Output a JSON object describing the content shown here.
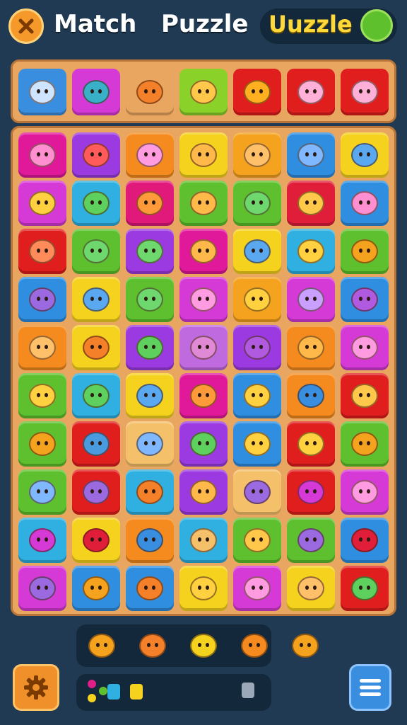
{
  "header": {
    "title_word1": "Match",
    "title_word2": "Puzzle",
    "brand": "Uuzzle"
  },
  "colors": {
    "background": "#1f3a52",
    "board": "#e9a660",
    "accent_yellow": "#ffd83a"
  },
  "icons": {
    "close": "close-x-icon",
    "brand_badge": "green-blob-icon",
    "settings": "gear-icon",
    "menu": "hamburger-menu-icon"
  },
  "tray": [
    {
      "color": "#3a8ee0",
      "icon": "arrow-icon"
    },
    {
      "color": "#d63ad6",
      "icon": "bird-icon"
    },
    {
      "color": "#e9a660",
      "icon": "orange-creature-icon"
    },
    {
      "color": "#8ad12a",
      "icon": "chick-icon"
    },
    {
      "color": "#e01e1e",
      "icon": "egg-icon"
    },
    {
      "color": "#e01e1e",
      "icon": "cat-face-icon"
    },
    {
      "color": "#e01e1e",
      "icon": "cat-face-icon"
    }
  ],
  "board": [
    [
      {
        "tile": "#e0199b",
        "face": "#ff8fd0",
        "icon": "pig-icon"
      },
      {
        "tile": "#9b3ae0",
        "face": "#ff5b5b",
        "icon": "fox-icon"
      },
      {
        "tile": "#f58b1e",
        "face": "#ff9be0",
        "icon": "pig-icon"
      },
      {
        "tile": "#f5d21e",
        "face": "#ffb84a",
        "icon": "lion-icon"
      },
      {
        "tile": "#f5a21e",
        "face": "#ffc06a",
        "icon": "lion-icon"
      },
      {
        "tile": "#2f8ee0",
        "face": "#7fb8ff",
        "icon": "bunny-icon"
      },
      {
        "tile": "#f5d21e",
        "face": "#5aa8f0",
        "icon": "owl-icon"
      }
    ],
    [
      {
        "tile": "#d63ad6",
        "face": "#ffd040",
        "icon": "cat-icon"
      },
      {
        "tile": "#2fb0e0",
        "face": "#5ed05e",
        "icon": "frog-icon"
      },
      {
        "tile": "#e0197a",
        "face": "#ff9a3a",
        "icon": "lion-icon"
      },
      {
        "tile": "#5ec02e",
        "face": "#ffb84a",
        "icon": "hedgehog-icon"
      },
      {
        "tile": "#5ec02e",
        "face": "#6ed86e",
        "icon": "dino-icon"
      },
      {
        "tile": "#e01e3a",
        "face": "#ffc84a",
        "icon": "bee-icon"
      },
      {
        "tile": "#2f8ee0",
        "face": "#ff8fd0",
        "icon": "pig-icon"
      }
    ],
    [
      {
        "tile": "#e01e1e",
        "face": "#ff8a5a",
        "icon": "fox-icon"
      },
      {
        "tile": "#5ec02e",
        "face": "#6ed86e",
        "icon": "frog-icon"
      },
      {
        "tile": "#9b3ae0",
        "face": "#6ed86e",
        "icon": "cat-icon"
      },
      {
        "tile": "#e0199b",
        "face": "#ffb84a",
        "icon": "hedgehog-icon"
      },
      {
        "tile": "#f5d21e",
        "face": "#5aa8f0",
        "icon": "fish-icon"
      },
      {
        "tile": "#2fb0e0",
        "face": "#ffd040",
        "icon": "bee-icon"
      },
      {
        "tile": "#5ec02e",
        "face": "#f5a21e",
        "icon": "carrot-icon"
      }
    ],
    [
      {
        "tile": "#2f8ee0",
        "face": "#9b6ae0",
        "icon": "cat-icon"
      },
      {
        "tile": "#f5d21e",
        "face": "#5aa8f0",
        "icon": "rocket-icon"
      },
      {
        "tile": "#5ec02e",
        "face": "#6ed86e",
        "icon": "frog-icon"
      },
      {
        "tile": "#d63ad6",
        "face": "#ff9be0",
        "icon": "pig-icon"
      },
      {
        "tile": "#f5a21e",
        "face": "#ffd040",
        "icon": "chick-icon"
      },
      {
        "tile": "#d63ad6",
        "face": "#c9a0ff",
        "icon": "cat-icon"
      },
      {
        "tile": "#2f8ee0",
        "face": "#b05ae0",
        "icon": "gift-icon"
      }
    ],
    [
      {
        "tile": "#f58b1e",
        "face": "#ffc06a",
        "icon": "bear-icon"
      },
      {
        "tile": "#f5d21e",
        "face": "#f5802a",
        "icon": "lion-icon"
      },
      {
        "tile": "#9b3ae0",
        "face": "#5ed05e",
        "icon": "carrot-icon"
      },
      {
        "tile": "#c06ae0",
        "face": "#e08ad6",
        "icon": "snail-icon"
      },
      {
        "tile": "#9b3ae0",
        "face": "#b05ae0",
        "icon": "cat-icon"
      },
      {
        "tile": "#f58b1e",
        "face": "#ffb84a",
        "icon": "cat-icon"
      },
      {
        "tile": "#d63ad6",
        "face": "#ff9be0",
        "icon": "pig-icon"
      }
    ],
    [
      {
        "tile": "#5ec02e",
        "face": "#ffd040",
        "icon": "cat-icon"
      },
      {
        "tile": "#2fb0e0",
        "face": "#5ed05e",
        "icon": "frog-icon"
      },
      {
        "tile": "#f5d21e",
        "face": "#5aa8f0",
        "icon": "rocket-icon"
      },
      {
        "tile": "#e0199b",
        "face": "#ff9a3a",
        "icon": "lion-icon"
      },
      {
        "tile": "#2f8ee0",
        "face": "#ffd040",
        "icon": "cat-icon"
      },
      {
        "tile": "#f58b1e",
        "face": "#3a8ee0",
        "icon": "bird-icon"
      },
      {
        "tile": "#e01e1e",
        "face": "#ffc84a",
        "icon": "cat-icon"
      }
    ],
    [
      {
        "tile": "#5ec02e",
        "face": "#f5a21e",
        "icon": "carrot-icon"
      },
      {
        "tile": "#e01e1e",
        "face": "#4a9ae0",
        "icon": "gift-icon"
      },
      {
        "tile": "#f5c06a",
        "face": "#7fb8ff",
        "icon": "fish-icon"
      },
      {
        "tile": "#9b3ae0",
        "face": "#5ed05e",
        "icon": "pepper-icon"
      },
      {
        "tile": "#2f8ee0",
        "face": "#ffd040",
        "icon": "orange-icon"
      },
      {
        "tile": "#e01e1e",
        "face": "#ffd040",
        "icon": "apple-icon"
      },
      {
        "tile": "#5ec02e",
        "face": "#f5a21e",
        "icon": "carrot-icon"
      }
    ],
    [
      {
        "tile": "#5ec02e",
        "face": "#7fb8ff",
        "icon": "cat-icon"
      },
      {
        "tile": "#e01e1e",
        "face": "#9b6ae0",
        "icon": "shell-icon"
      },
      {
        "tile": "#2fb0e0",
        "face": "#f5802a",
        "icon": "bear-icon"
      },
      {
        "tile": "#9b3ae0",
        "face": "#ffb84a",
        "icon": "lion-icon"
      },
      {
        "tile": "#f5c06a",
        "face": "#9b6ae0",
        "icon": "dice-icon"
      },
      {
        "tile": "#e01e1e",
        "face": "#d63ad6",
        "icon": "rocket-icon"
      },
      {
        "tile": "#d63ad6",
        "face": "#ff9be0",
        "icon": "pig-icon"
      }
    ],
    [
      {
        "tile": "#2fb0e0",
        "face": "#d63ad6",
        "icon": "snail-icon"
      },
      {
        "tile": "#f5d21e",
        "face": "#e01e3a",
        "icon": "crayon-icon"
      },
      {
        "tile": "#f58b1e",
        "face": "#3a8ee0",
        "icon": "crayon-icon"
      },
      {
        "tile": "#2fb0e0",
        "face": "#f5c06a",
        "icon": "bone-icon"
      },
      {
        "tile": "#5ec02e",
        "face": "#ffc84a",
        "icon": "bee-icon"
      },
      {
        "tile": "#5ec02e",
        "face": "#9b6ae0",
        "icon": "blob-icon"
      },
      {
        "tile": "#2f8ee0",
        "face": "#e01e3a",
        "icon": "apple-icon"
      }
    ],
    [
      {
        "tile": "#d63ad6",
        "face": "#9b6ae0",
        "icon": "sticks-icon"
      },
      {
        "tile": "#2f8ee0",
        "face": "#f5a21e",
        "icon": "carrot-icon"
      },
      {
        "tile": "#2f8ee0",
        "face": "#f5802a",
        "icon": "bear-icon"
      },
      {
        "tile": "#f5d21e",
        "face": "#ffd040",
        "icon": "cat-icon"
      },
      {
        "tile": "#d63ad6",
        "face": "#ff9be0",
        "icon": "pig-icon"
      },
      {
        "tile": "#f5d21e",
        "face": "#ffc06a",
        "icon": "cat-icon"
      },
      {
        "tile": "#e01e1e",
        "face": "#5ed05e",
        "icon": "leaf-icon"
      }
    ]
  ],
  "collected": [
    {
      "color": "#f5a21e",
      "icon": "shell-icon"
    },
    {
      "color": "#f5802a",
      "icon": "bear-icon"
    },
    {
      "color": "#f5d21e",
      "icon": "cheese-icon"
    },
    {
      "color": "#f58b1e",
      "icon": "carrot-icon"
    },
    {
      "color": "#f5a21e",
      "icon": "star-creature-icon"
    }
  ],
  "dock_items": [
    {
      "color": "#e01e8a",
      "icon": "dot-icon"
    },
    {
      "color": "#f5d21e",
      "icon": "dot-icon"
    },
    {
      "color": "#5ec02e",
      "icon": "dot-icon"
    },
    {
      "color": "#2fb0e0",
      "icon": "small-shape-icon"
    },
    {
      "color": "#f5d21e",
      "icon": "small-shape-icon"
    },
    {
      "color": "#9aa8b8",
      "icon": "small-creature-icon"
    }
  ]
}
